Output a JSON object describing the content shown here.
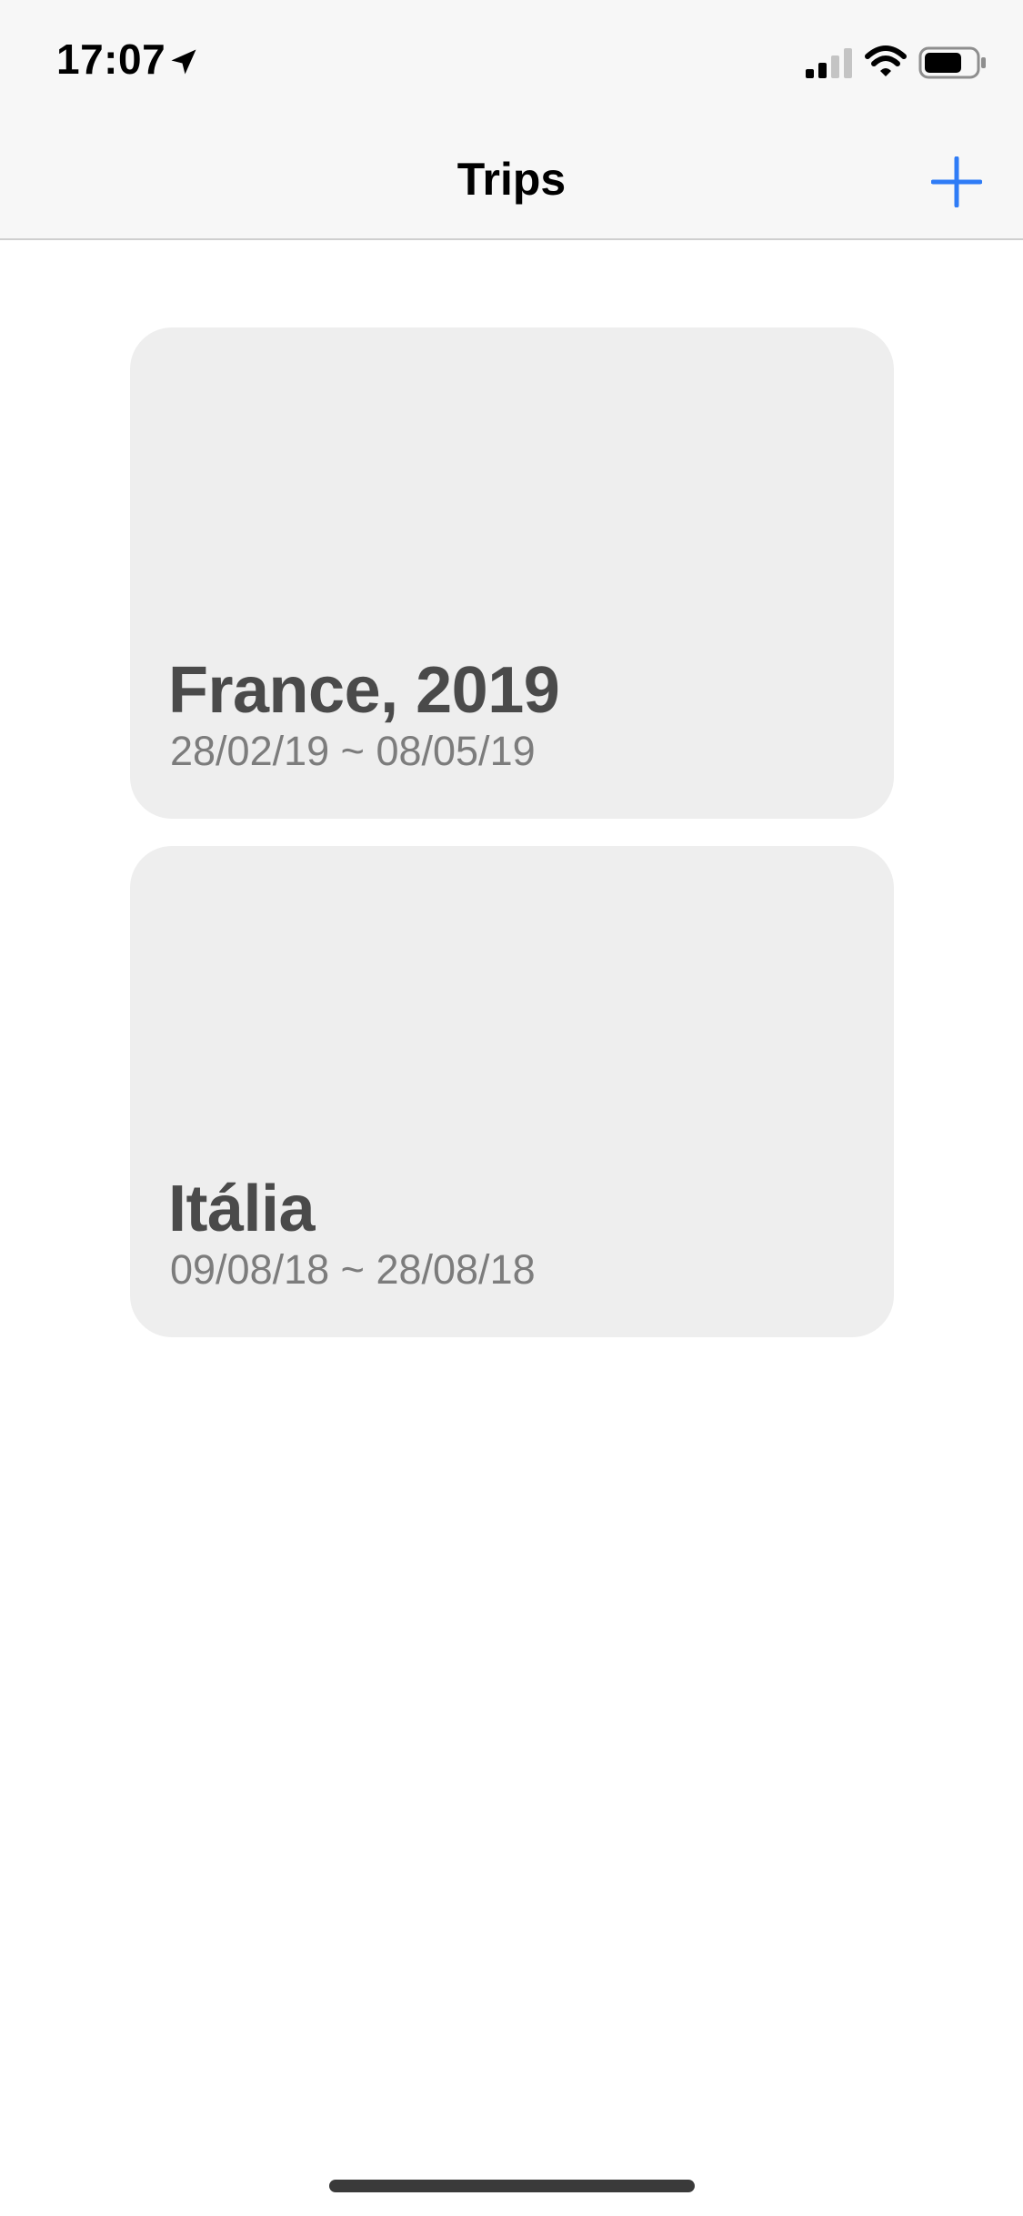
{
  "status_bar": {
    "time": "17:07",
    "icons": [
      "location-arrow-icon",
      "cellular-signal-icon",
      "wifi-icon",
      "battery-icon"
    ]
  },
  "nav": {
    "title": "Trips",
    "add_icon": "plus-icon",
    "accent_color": "#2f7cf6"
  },
  "trips": [
    {
      "title": "France, 2019",
      "dates": "28/02/19 ~ 08/05/19"
    },
    {
      "title": "Itália",
      "dates": "09/08/18 ~ 28/08/18"
    }
  ],
  "colors": {
    "nav_background": "#f7f7f7",
    "card_background": "#eeeeee",
    "card_title": "#4a4a4a",
    "card_dates": "#7c7c7c"
  }
}
